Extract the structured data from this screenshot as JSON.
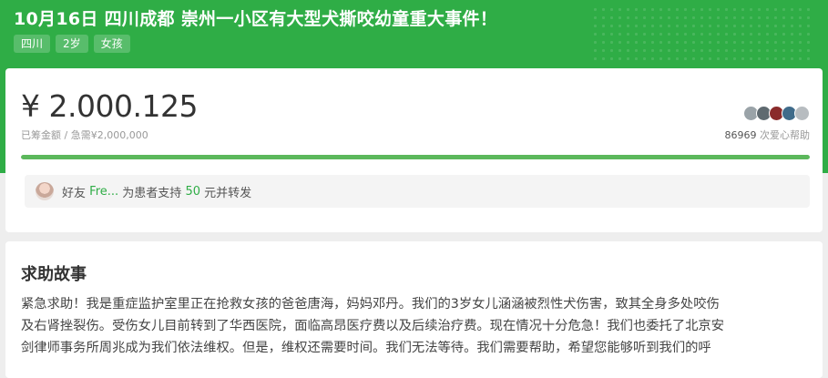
{
  "header": {
    "title": "10月16日 四川成都 崇州一小区有大型犬撕咬幼童重大事件！",
    "tags": [
      "四川",
      "2岁",
      "女孩"
    ]
  },
  "funding": {
    "currency": "¥",
    "amount": "2.000.125",
    "raised_label": "已筹金额",
    "separator": "/",
    "target_label": "急需¥2,000,000",
    "supporter_count": "86969",
    "supporter_suffix": "次爱心帮助",
    "progress_fraction": 1.0
  },
  "share": {
    "prefix": "好友",
    "friend_name": "Fre...",
    "middle": "为患者支持",
    "amount": "50",
    "suffix": "元并转发"
  },
  "story": {
    "title": "求助故事",
    "lines": [
      "紧急求助！我是重症监护室里正在抢救女孩的爸爸唐海，妈妈邓丹。我们的3岁女儿涵涵被烈性犬伤害，致其全身多处咬伤",
      "及右肾挫裂伤。受伤女儿目前转到了华西医院，面临高昂医疗费以及后续治疗费。现在情况十分危急！我们也委托了北京安",
      "剑律师事务所周兆成为我们依法维权。但是，维权还需要时间。我们无法等待。我们需要帮助，希望您能够听到我们的呼"
    ]
  },
  "colors": {
    "brand_green": "#2fad46",
    "progress_green": "#5cb85c"
  }
}
